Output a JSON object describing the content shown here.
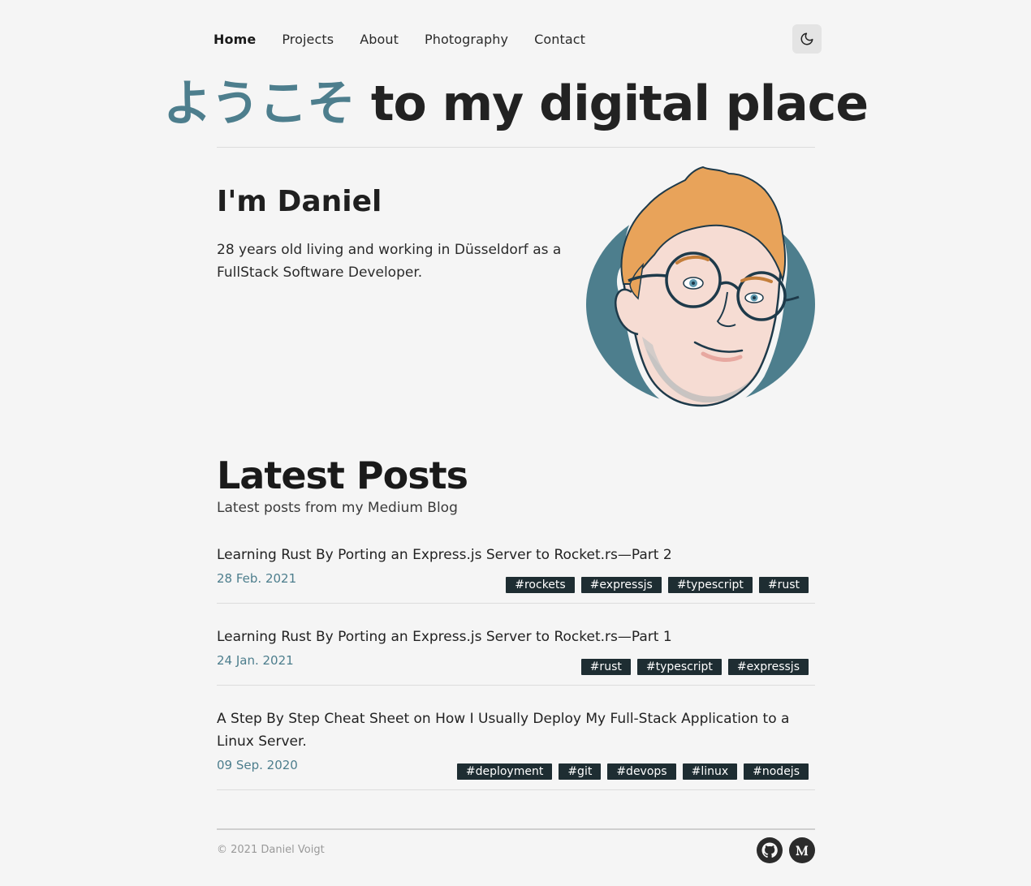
{
  "nav": {
    "items": [
      {
        "label": "Home",
        "active": true
      },
      {
        "label": "Projects",
        "active": false
      },
      {
        "label": "About",
        "active": false
      },
      {
        "label": "Photography",
        "active": false
      },
      {
        "label": "Contact",
        "active": false
      }
    ],
    "theme_toggle_icon": "moon-icon"
  },
  "hero": {
    "accent": "ようこそ",
    "rest": " to my digital place",
    "accent_color": "#4d7e8d"
  },
  "intro": {
    "title": "I'm Daniel",
    "text": "28 years old living and working in Düsseldorf as a FullStack Software Developer."
  },
  "posts": {
    "title": "Latest Posts",
    "subtitle": "Latest posts from my Medium Blog",
    "items": [
      {
        "title": "Learning Rust By Porting an Express.js Server to Rocket.rs—Part 2",
        "date": "28 Feb. 2021",
        "tags": [
          "#rockets",
          "#expressjs",
          "#typescript",
          "#rust"
        ]
      },
      {
        "title": "Learning Rust By Porting an Express.js Server to Rocket.rs—Part 1",
        "date": "24 Jan. 2021",
        "tags": [
          "#rust",
          "#typescript",
          "#expressjs"
        ]
      },
      {
        "title": "A Step By Step Cheat Sheet on How I Usually Deploy My Full-Stack Application to a Linux Server.",
        "date": "09 Sep. 2020",
        "tags": [
          "#deployment",
          "#git",
          "#devops",
          "#linux",
          "#nodejs"
        ]
      }
    ]
  },
  "footer": {
    "copyright": "© 2021 Daniel Voigt",
    "social": [
      "github-icon",
      "medium-icon"
    ]
  }
}
